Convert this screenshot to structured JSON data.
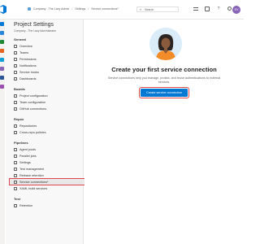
{
  "topbar": {
    "breadcrumbs": [
      "Company - The Lazy Admin",
      "Settings",
      "Service connections*"
    ],
    "search_placeholder": "Search",
    "avatar_initials": "EV"
  },
  "settings_panel": {
    "title": "Project Settings",
    "subtitle": "Company - The Lazy Administrator",
    "sections": [
      {
        "heading": "General",
        "items": [
          "Overview",
          "Teams",
          "Permissions",
          "Notifications",
          "Service hooks",
          "Dashboards"
        ]
      },
      {
        "heading": "Boards",
        "items": [
          "Project configuration",
          "Team configuration",
          "GitHub connections"
        ]
      },
      {
        "heading": "Repos",
        "items": [
          "Repositories",
          "Cross-repo policies"
        ]
      },
      {
        "heading": "Pipelines",
        "items": [
          "Agent pools",
          "Parallel jobs",
          "Settings",
          "Test management",
          "Release retention",
          "Service connections*",
          "XAML build services"
        ]
      },
      {
        "heading": "Test",
        "items": [
          "Retention"
        ]
      }
    ],
    "selected_item": "Service connections*"
  },
  "main": {
    "headline": "Create your first service connection",
    "description": "Service connections help you manage, protect, and reuse authentications to external services.",
    "cta_label": "Create service connection"
  },
  "colors": {
    "accent": "#0078d4",
    "highlight_outline": "#e0474c",
    "avatar": "#8764b8"
  }
}
